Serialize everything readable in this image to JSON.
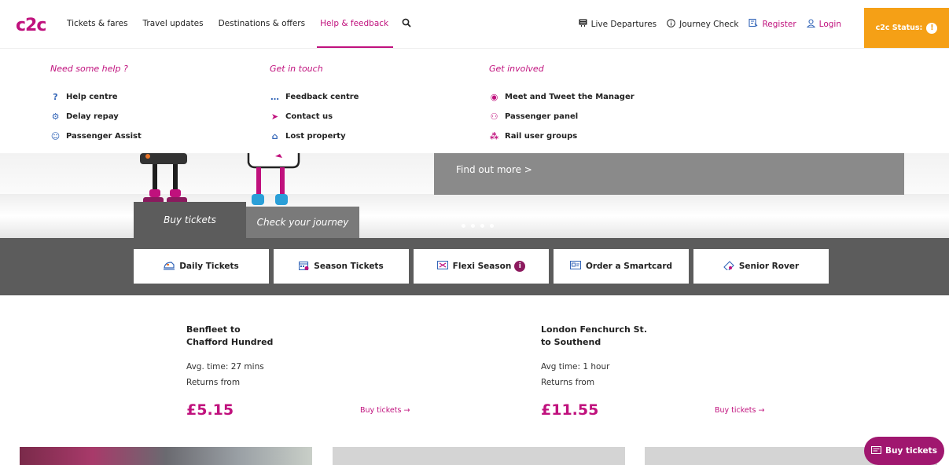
{
  "header": {
    "logo": "c2c",
    "nav": [
      {
        "label": "Tickets & fares"
      },
      {
        "label": "Travel updates"
      },
      {
        "label": "Destinations & offers"
      },
      {
        "label": "Help & feedback"
      }
    ],
    "search_icon": "search-icon",
    "utility": [
      {
        "label": "Live Departures",
        "icon": "departures-board-icon"
      },
      {
        "label": "Journey Check",
        "icon": "info-circle-icon"
      },
      {
        "label": "Register",
        "icon": "register-icon"
      },
      {
        "label": "Login",
        "icon": "user-icon"
      }
    ],
    "status_label": "c2c Status:",
    "status_icon": "!"
  },
  "menu": {
    "columns": [
      {
        "title": "Need some help ?",
        "links": [
          "Help centre",
          "Delay repay",
          "Passenger Assist"
        ]
      },
      {
        "title": "Get in touch",
        "links": [
          "Feedback centre",
          "Contact us",
          "Lost property"
        ]
      },
      {
        "title": "Get involved",
        "links": [
          "Meet and Tweet the Manager",
          "Passenger panel",
          "Rail user groups"
        ]
      }
    ]
  },
  "hero": {
    "promo_link": "Find out more >"
  },
  "tabs": {
    "buy": "Buy tickets",
    "check": "Check your journey"
  },
  "ticket_types": [
    {
      "label": "Daily Tickets",
      "icon": "train-icon"
    },
    {
      "label": "Season Tickets",
      "icon": "calendar-icon"
    },
    {
      "label": "Flexi Season",
      "icon": "flexi-card-icon",
      "badge": "i"
    },
    {
      "label": "Order a Smartcard",
      "icon": "smartcard-icon"
    },
    {
      "label": "Senior Rover",
      "icon": "ticket-icon"
    }
  ],
  "journeys": [
    {
      "title_line1": "Benfleet to",
      "title_line2": "Chafford Hundred",
      "avg": "Avg. time: 27 mins",
      "returns": "Returns from",
      "price": "£5.15",
      "buy": "Buy tickets →"
    },
    {
      "title_line1": "London Fenchurch St.",
      "title_line2": "to Southend",
      "avg": "Avg time: 1 hour",
      "returns": "Returns from",
      "price": "£11.55",
      "buy": "Buy tickets →"
    }
  ],
  "float_button": "Buy tickets",
  "colors": {
    "brand": "#c0117d",
    "status": "#f5a016",
    "bar": "#5c5c5c"
  }
}
